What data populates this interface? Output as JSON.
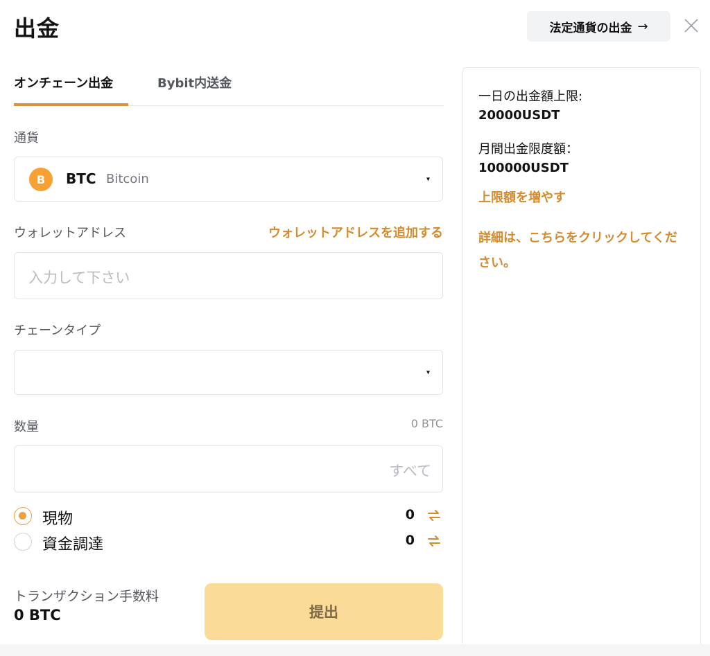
{
  "page": {
    "title": "出金",
    "fiat_button": "法定通貨の出金",
    "fiat_arrow": "→"
  },
  "tabs": [
    {
      "label": "オンチェーン出金",
      "active": true
    },
    {
      "label": "Bybit内送金",
      "active": false
    }
  ],
  "currency": {
    "label": "通貨",
    "symbol": "BTC",
    "name": "Bitcoin",
    "icon_glyph": "B"
  },
  "address": {
    "label": "ウォレットアドレス",
    "add_link": "ウォレットアドレスを追加する",
    "placeholder": "入力して下さい"
  },
  "chain": {
    "label": "チェーンタイプ",
    "value": ""
  },
  "amount": {
    "label": "数量",
    "available": "0 BTC",
    "all_button": "すべて"
  },
  "accounts": [
    {
      "label": "現物",
      "value": "0",
      "checked": true
    },
    {
      "label": "資金調達",
      "value": "0",
      "checked": false
    }
  ],
  "fee": {
    "label": "トランザクション手数料",
    "value": "0 BTC"
  },
  "submit_label": "提出",
  "side": {
    "daily_label": "一日の出金額上限:",
    "daily_value": "20000USDT",
    "monthly_label": "月間出金限度額：",
    "monthly_value": "100000USDT",
    "increase_link": "上限額を増やす",
    "details_link": "詳細は、こちらをクリックしてください。"
  },
  "colors": {
    "accent": "#d38b2e",
    "submit_bg": "#fadb97",
    "radio_checked": "#e9a23f",
    "btc_orange": "#f7a132"
  },
  "icons": {
    "close": "close-icon",
    "swap": "swap-icon",
    "coin": "bitcoin-icon",
    "caret": "caret-down-icon"
  }
}
